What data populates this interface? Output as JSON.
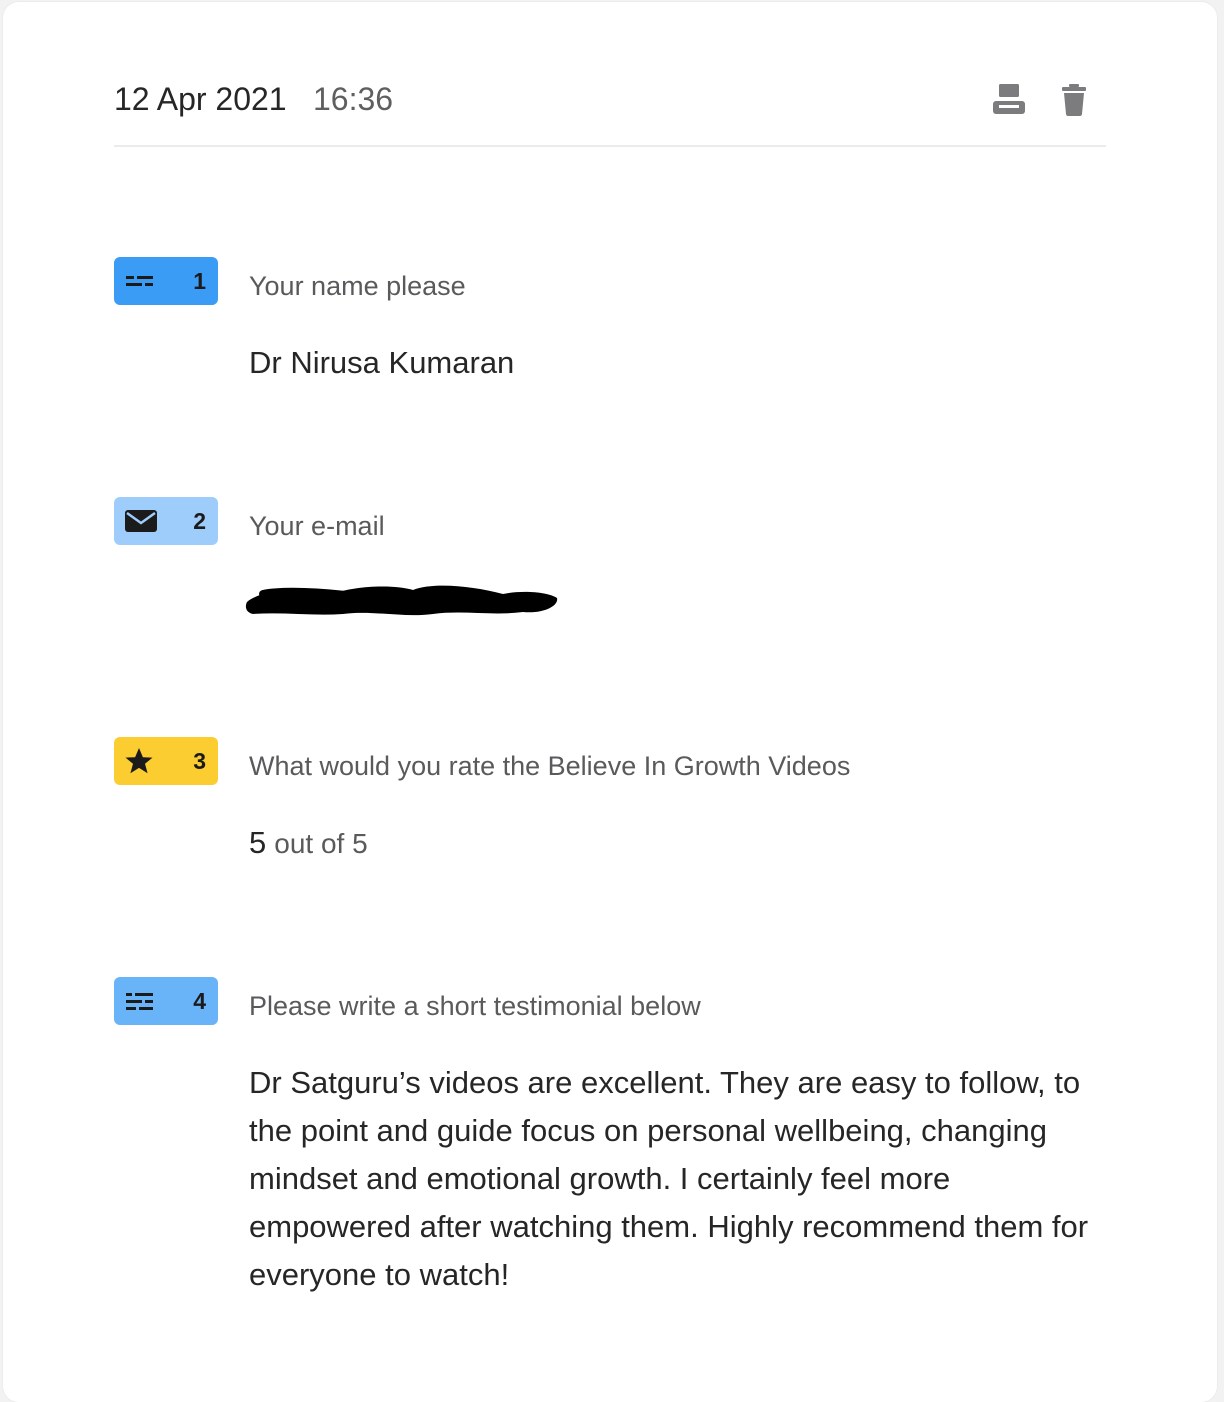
{
  "header": {
    "date": "12 Apr 2021",
    "time": "16:36",
    "print_icon": "printer-icon",
    "delete_icon": "trash-icon"
  },
  "questions": [
    {
      "number": "1",
      "icon": "short-text-icon",
      "badge_color": "#3b9cf5",
      "label": "Your name please",
      "answer": "Dr Nirusa Kumaran"
    },
    {
      "number": "2",
      "icon": "envelope-icon",
      "badge_color": "#9fcdfb",
      "label": "Your e-mail",
      "answer": ""
    },
    {
      "number": "3",
      "icon": "star-icon",
      "badge_color": "#fbcd30",
      "label": "What would you rate the Believe In Growth Videos",
      "rating": "5",
      "rating_suffix": "out of 5"
    },
    {
      "number": "4",
      "icon": "long-text-icon",
      "badge_color": "#69b4f8",
      "label": "Please write a short testimonial below",
      "answer": "Dr Satguru’s videos are excellent. They are easy to follow, to the point and guide focus on personal wellbeing, changing mindset and emotional growth. I certainly feel more empowered after watching them. Highly recommend them for everyone to watch!"
    }
  ]
}
